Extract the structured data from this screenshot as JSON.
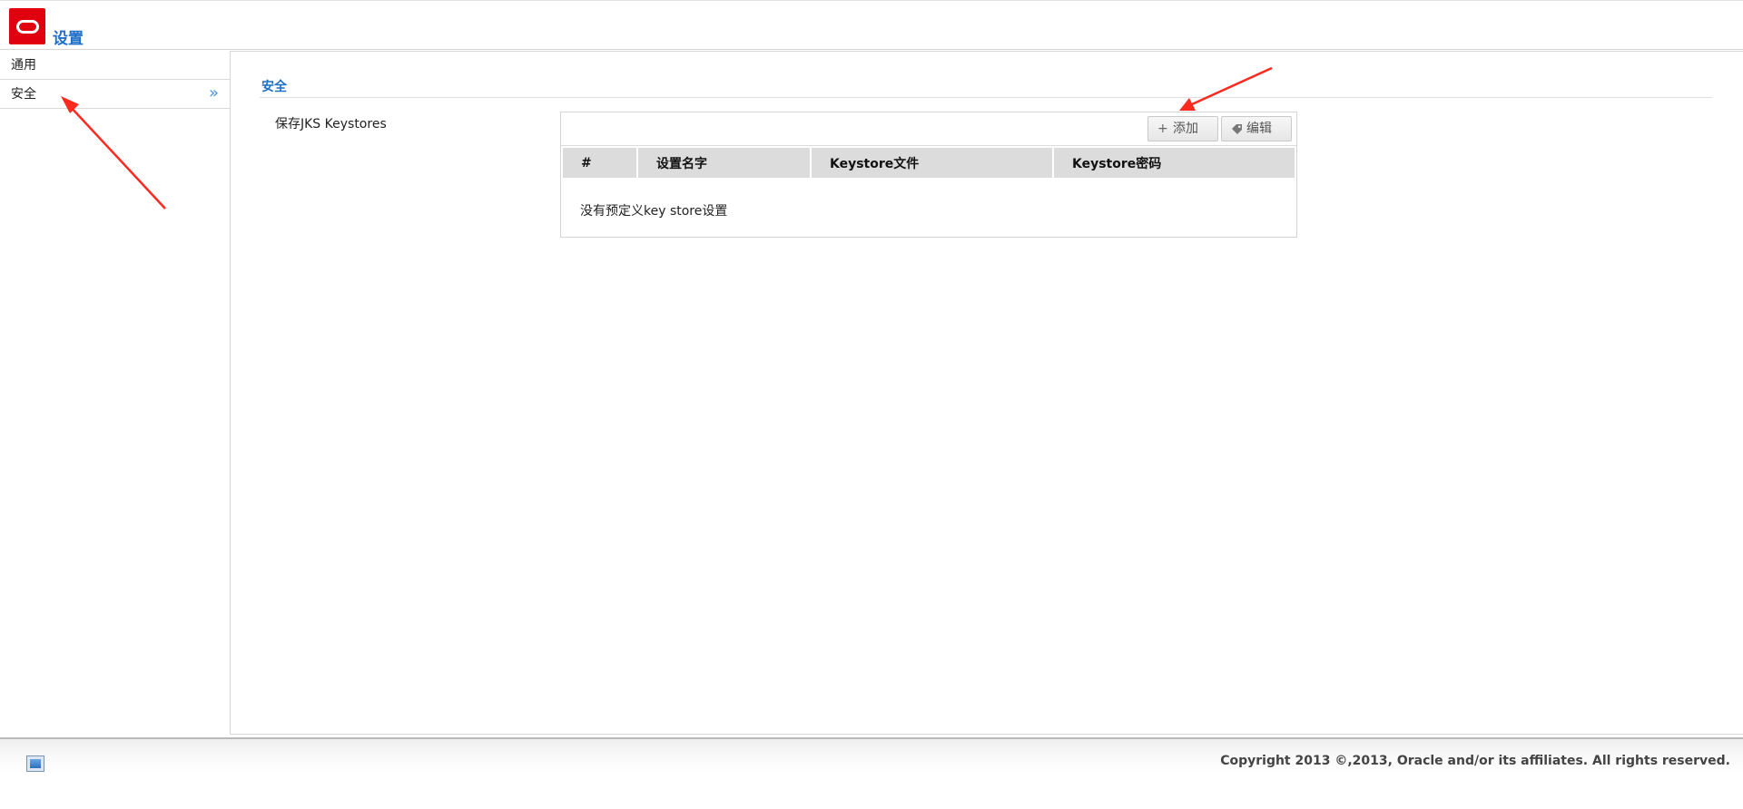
{
  "header": {
    "title": "设置",
    "logo_icon": "oracle-logo-icon"
  },
  "sidebar": {
    "items": [
      {
        "label": "通用",
        "selected": false
      },
      {
        "label": "安全",
        "selected": true,
        "indicator": "»"
      }
    ]
  },
  "main": {
    "section_title": "安全",
    "field_label": "保存JKS Keystores",
    "toolbar": {
      "add_label": "添加",
      "add_icon": "plus-icon",
      "edit_label": "编辑",
      "edit_icon": "tag-icon"
    },
    "table": {
      "columns": [
        "#",
        "设置名字",
        "Keystore文件",
        "Keystore密码"
      ],
      "empty_message": "没有预定义key store设置"
    }
  },
  "footer": {
    "copyright": "Copyright 2013 ©,2013, Oracle and/or its affiliates. All rights reserved.",
    "icon": "image-icon"
  },
  "colors": {
    "accent": "#1f6fc6",
    "logo_red": "#e0000e",
    "annotation_red": "#ff2a1f"
  }
}
